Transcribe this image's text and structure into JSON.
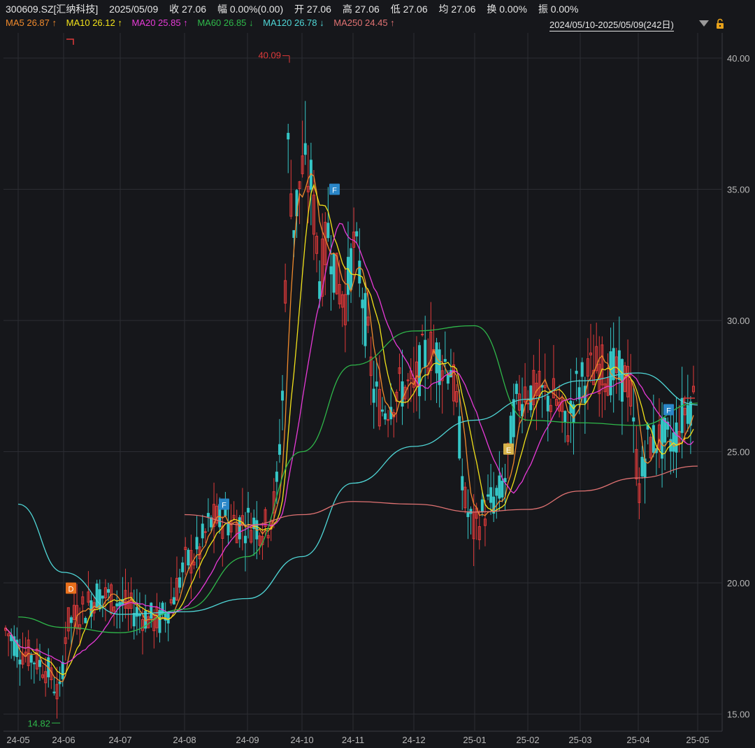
{
  "header": {
    "symbol": "300609.SZ[汇纳科技]",
    "date": "2025/05/09",
    "close": "收 27.06",
    "change": "幅 0.00%(0.00)",
    "open": "开 27.06",
    "high": "高 27.06",
    "low": "低 27.06",
    "avg": "均 27.06",
    "turnover": "换 0.00%",
    "amplitude": "振 0.00%"
  },
  "ma": [
    {
      "label": "MA5 26.87 ↑",
      "color": "#f08a2c"
    },
    {
      "label": "MA10 26.12 ↑",
      "color": "#f2e21a"
    },
    {
      "label": "MA20 25.85 ↑",
      "color": "#e83ad8"
    },
    {
      "label": "MA60 26.85 ↓",
      "color": "#2fb84a"
    },
    {
      "label": "MA120 26.78 ↓",
      "color": "#4fd6d6"
    },
    {
      "label": "MA250 24.45 ↑",
      "color": "#e07272"
    }
  ],
  "range_label": "2024/05/10-2025/05/09(242日)",
  "icons": {
    "dropdown": "chevron-down-icon",
    "lock": "lock-icon"
  },
  "colors": {
    "up": "#e03a3a",
    "down": "#35c6c6",
    "grid": "#2c2d33",
    "background": "#16171b"
  },
  "chart_data": {
    "type": "candlestick",
    "title": "",
    "ylim": [
      15,
      40
    ],
    "yticks": [
      "40.00",
      "35.00",
      "30.00",
      "25.00",
      "20.00",
      "15.00"
    ],
    "ytick_values": [
      40,
      35,
      30,
      25,
      20,
      15
    ],
    "xticks": [
      "24-05",
      "24-06",
      "24-07",
      "24-08",
      "24-09",
      "24-10",
      "24-11",
      "24-12",
      "25-01",
      "25-02",
      "25-03",
      "25-04",
      "25-05"
    ],
    "high_annotation": {
      "label": "40.09",
      "value": 40.09,
      "date": "24-10"
    },
    "low_annotation": {
      "label": "14.82",
      "value": 14.82,
      "date": "24-06"
    },
    "marker_labels": [
      "D",
      "F",
      "F",
      "E",
      "F"
    ],
    "markers": [
      {
        "label": "D",
        "date": "24-06",
        "value": 19.8,
        "color": "#e8701c"
      },
      {
        "label": "F",
        "date": "24-08",
        "value": 23.0,
        "color": "#2a86c8"
      },
      {
        "label": "F",
        "date": "24-10",
        "value": 35.0,
        "color": "#2a86c8"
      },
      {
        "label": "E",
        "date": "25-01",
        "value": 25.1,
        "color": "#d8b24a"
      },
      {
        "label": "F",
        "date": "25-04",
        "value": 26.6,
        "color": "#2a86c8"
      }
    ],
    "ma_trend": [
      {
        "name": "MA60",
        "dates": [
          "24-05",
          "24-06",
          "24-07",
          "24-08",
          "24-09",
          "24-10",
          "24-11",
          "24-12",
          "25-01",
          "25-02",
          "25-03",
          "25-04",
          "25-05"
        ],
        "values": [
          18.7,
          18.3,
          18.1,
          19.0,
          21.0,
          25.0,
          28.3,
          29.6,
          29.8,
          26.2,
          26.1,
          26.0,
          26.85
        ]
      },
      {
        "name": "MA120",
        "dates": [
          "24-05",
          "24-06",
          "24-07",
          "24-08",
          "24-09",
          "24-10",
          "24-11",
          "24-12",
          "25-01",
          "25-02",
          "25-03",
          "25-04",
          "25-05"
        ],
        "values": [
          23.0,
          20.4,
          18.8,
          18.9,
          19.4,
          21.0,
          23.8,
          25.2,
          26.2,
          27.0,
          27.7,
          28.0,
          26.78
        ]
      },
      {
        "name": "MA250",
        "dates": [
          "24-08",
          "24-09",
          "24-10",
          "24-11",
          "24-12",
          "25-01",
          "25-02",
          "25-03",
          "25-04",
          "25-05"
        ],
        "values": [
          22.6,
          22.2,
          22.6,
          23.1,
          23.0,
          22.7,
          22.8,
          23.5,
          24.0,
          24.45
        ]
      }
    ]
  }
}
